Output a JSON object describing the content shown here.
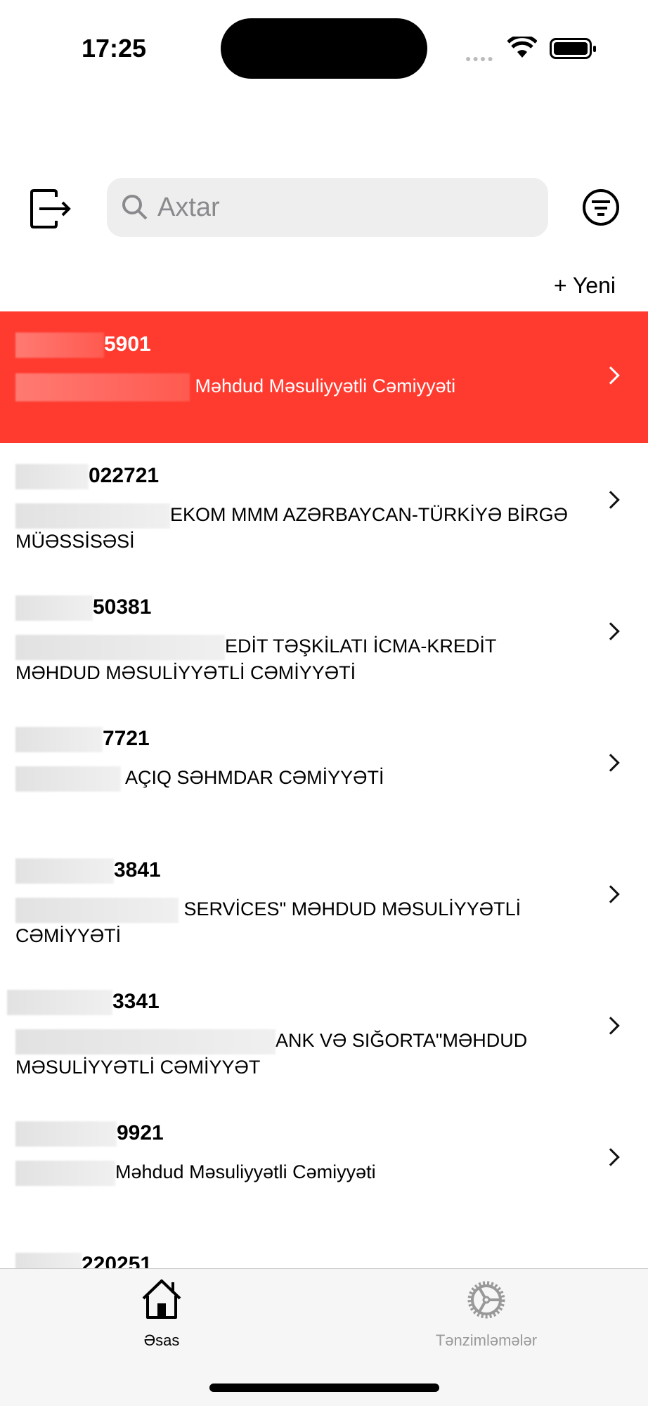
{
  "status": {
    "time": "17:25"
  },
  "header": {
    "search_placeholder": "Axtar",
    "new_label": "+ Yeni"
  },
  "items": [
    {
      "id": "5901",
      "name": "Məhdud Məsuliyyətli Cəmiyyəti",
      "active": true
    },
    {
      "id": "022721",
      "name": "EKOM MMM AZƏRBAYCAN-TÜRKİYƏ BİRGƏ MÜƏSSİSƏSİ"
    },
    {
      "id": "50381",
      "name": "EDİT TƏŞKİLATI İCMA-KREDİT MƏHDUD MƏSULİYYƏTLİ CƏMİYYƏTİ"
    },
    {
      "id": "7721",
      "name": "AÇIQ SƏHMDAR CƏMİYYƏTİ"
    },
    {
      "id": "3841",
      "name": "SERVİCES\" MƏHDUD MƏSULİYYƏTLİ CƏMİYYƏTİ"
    },
    {
      "id": "3341",
      "name": "ANK VƏ SIĞORTA\"MƏHDUD MƏSULİYYƏTLİ CƏMİYYƏT"
    },
    {
      "id": "9921",
      "name": "Məhdud Məsuliyyətli Cəmiyyəti"
    },
    {
      "id": "220251",
      "name": ""
    }
  ],
  "tabs": [
    {
      "label": "Əsas"
    },
    {
      "label": "Tənzimləmələr"
    }
  ],
  "colors": {
    "accent": "#ff3b30",
    "inactive": "#999999"
  }
}
